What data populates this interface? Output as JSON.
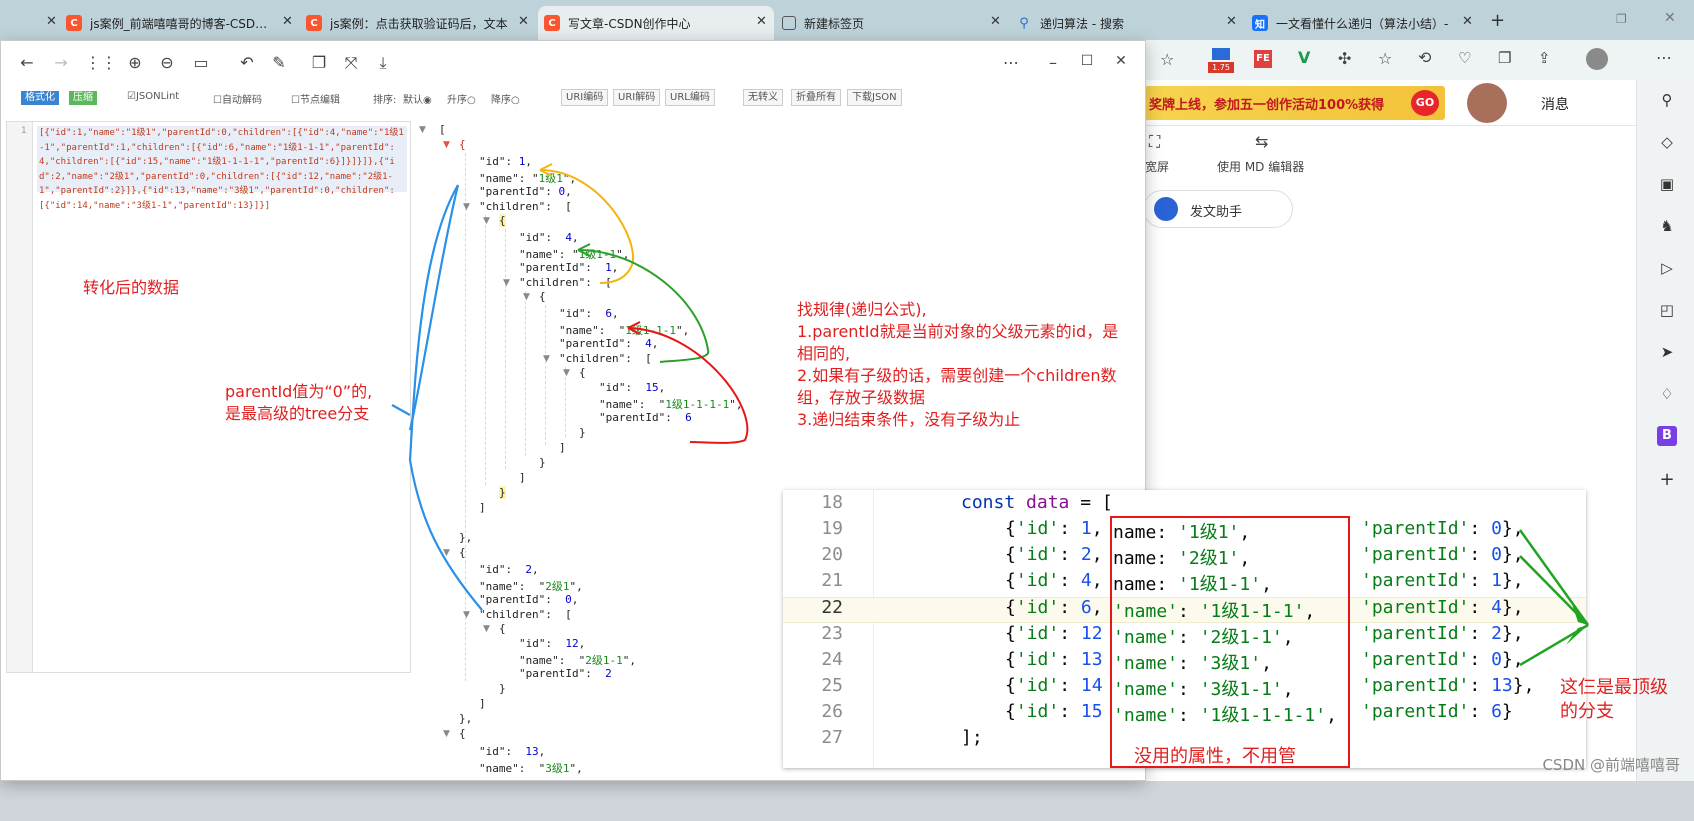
{
  "browser": {
    "tabs": [
      {
        "label": "js案例_前端嘻嘻哥的博客-CSDN博",
        "icon": "csdn-icon",
        "active": false
      },
      {
        "label": "js案例：点击获取验证码后，文本",
        "icon": "csdn-icon",
        "active": false
      },
      {
        "label": "写文章-CSDN创作中心",
        "icon": "csdn-icon",
        "active": true
      },
      {
        "label": "新建标签页",
        "icon": "newtab-icon",
        "active": false
      },
      {
        "label": "递归算法 - 搜索",
        "icon": "search-icon",
        "active": false
      },
      {
        "label": "一文看懂什么递归（算法小结）-",
        "icon": "zhihu-icon",
        "active": false
      }
    ],
    "extension_badge": "1.75",
    "csdn_favicon": "C",
    "zhihu_favicon": "知"
  },
  "csdn_editor": {
    "banner_text": "奖牌上线，参加五一创作活动100%获得",
    "banner_button": "GO",
    "messages_label": "消息",
    "wide_screen_label": "宽屏",
    "md_editor_label": "使用 MD 编辑器",
    "assistant_label": "发文助手"
  },
  "json_tool": {
    "format_button": "格式化",
    "compress_button": "压缩",
    "opt_jsonlint": "JSONLint",
    "opt_autodecode": "自动解码",
    "opt_nodeedit": "节点编辑",
    "sort_label": "排序:",
    "sort_default": "默认",
    "sort_asc": "升序",
    "sort_desc": "降序",
    "btn_uri_encode": "URI编码",
    "btn_uri_decode": "URI解码",
    "btn_url_encode": "URL编码",
    "btn_no_escape": "无转义",
    "btn_fold_all": "折叠所有",
    "btn_download": "下载JSON",
    "gutter_line": "1",
    "raw_json": "[{\"id\":1,\"name\":\"1级1\",\"parentId\":0,\"children\":[{\"id\":4,\"name\":\"1级1-1\",\"parentId\":1,\"children\":[{\"id\":6,\"name\":\"1级1-1-1\",\"parentId\":4,\"children\":[{\"id\":15,\"name\":\"1级1-1-1-1\",\"parentId\":6}]}]}]},{\"id\":2,\"name\":\"2级1\",\"parentId\":0,\"children\":[{\"id\":12,\"name\":\"2级1-1\",\"parentId\":2}]},{\"id\":13,\"name\":\"3级1\",\"parentId\":0,\"children\":[{\"id\":14,\"name\":\"3级1-1\",\"parentId\":13}]}]"
  },
  "tree": {
    "n1": {
      "id": "1",
      "name": "1级1",
      "parentId": "0"
    },
    "n4": {
      "id": "4",
      "name": "1级1-1",
      "parentId": "1"
    },
    "n6": {
      "id": "6",
      "name": "1级1-1-1",
      "parentId": "4"
    },
    "n15": {
      "id": "15",
      "name": "1级1-1-1-1",
      "parentId": "6"
    },
    "n2": {
      "id": "2",
      "name": "2级1",
      "parentId": "0"
    },
    "n12": {
      "id": "12",
      "name": "2级1-1",
      "parentId": "2"
    },
    "n13": {
      "id": "13",
      "name": "3级1"
    },
    "k_id": "\"id\":",
    "k_name": "\"name\":",
    "k_parentId": "\"parentId\":",
    "k_children": "\"children\":"
  },
  "annotations": {
    "converted": "转化后的数据",
    "parentid_line1": "parentId值为“0”的,",
    "parentid_line2": "是最高级的tree分支",
    "rule_title": "找规律(递归公式),",
    "rule_1a": "1.parentId就是当前对象的父级元素的id，是",
    "rule_1b": "相同的,",
    "rule_2a": "2.如果有子级的话，需要创建一个children数",
    "rule_2b": "组，存放子级数据",
    "rule_3": "3.递归结束条件，没有子级为止",
    "top_level_1": "这仨是最顶级",
    "top_level_2": "的分支",
    "unused": "没用的属性，不用管"
  },
  "code": {
    "line_numbers": [
      "18",
      "19",
      "20",
      "21",
      "22",
      "23",
      "24",
      "25",
      "26",
      "27"
    ],
    "decl_kw": "const",
    "decl_var": "data",
    "decl_rest": " = [",
    "rows": [
      {
        "id": "1",
        "name": "'1级1'",
        "pid": "0"
      },
      {
        "id": "2",
        "name": "'2级1'",
        "pid": "0"
      },
      {
        "id": "4",
        "name": "'1级1-1'",
        "pid": "1"
      },
      {
        "id": "6",
        "name": "'1级1-1-1'",
        "pid": "4"
      },
      {
        "id": "12",
        "name": "'2级1-1'",
        "pid": "2"
      },
      {
        "id": "13",
        "name": "'3级1'",
        "pid": "0"
      },
      {
        "id": "14",
        "name": "'3级1-1'",
        "pid": "13"
      },
      {
        "id": "15",
        "name": "'1级1-1-1-1'",
        "pid": "6"
      }
    ],
    "close": "];"
  },
  "watermark": "CSDN @前端嘻嘻哥"
}
